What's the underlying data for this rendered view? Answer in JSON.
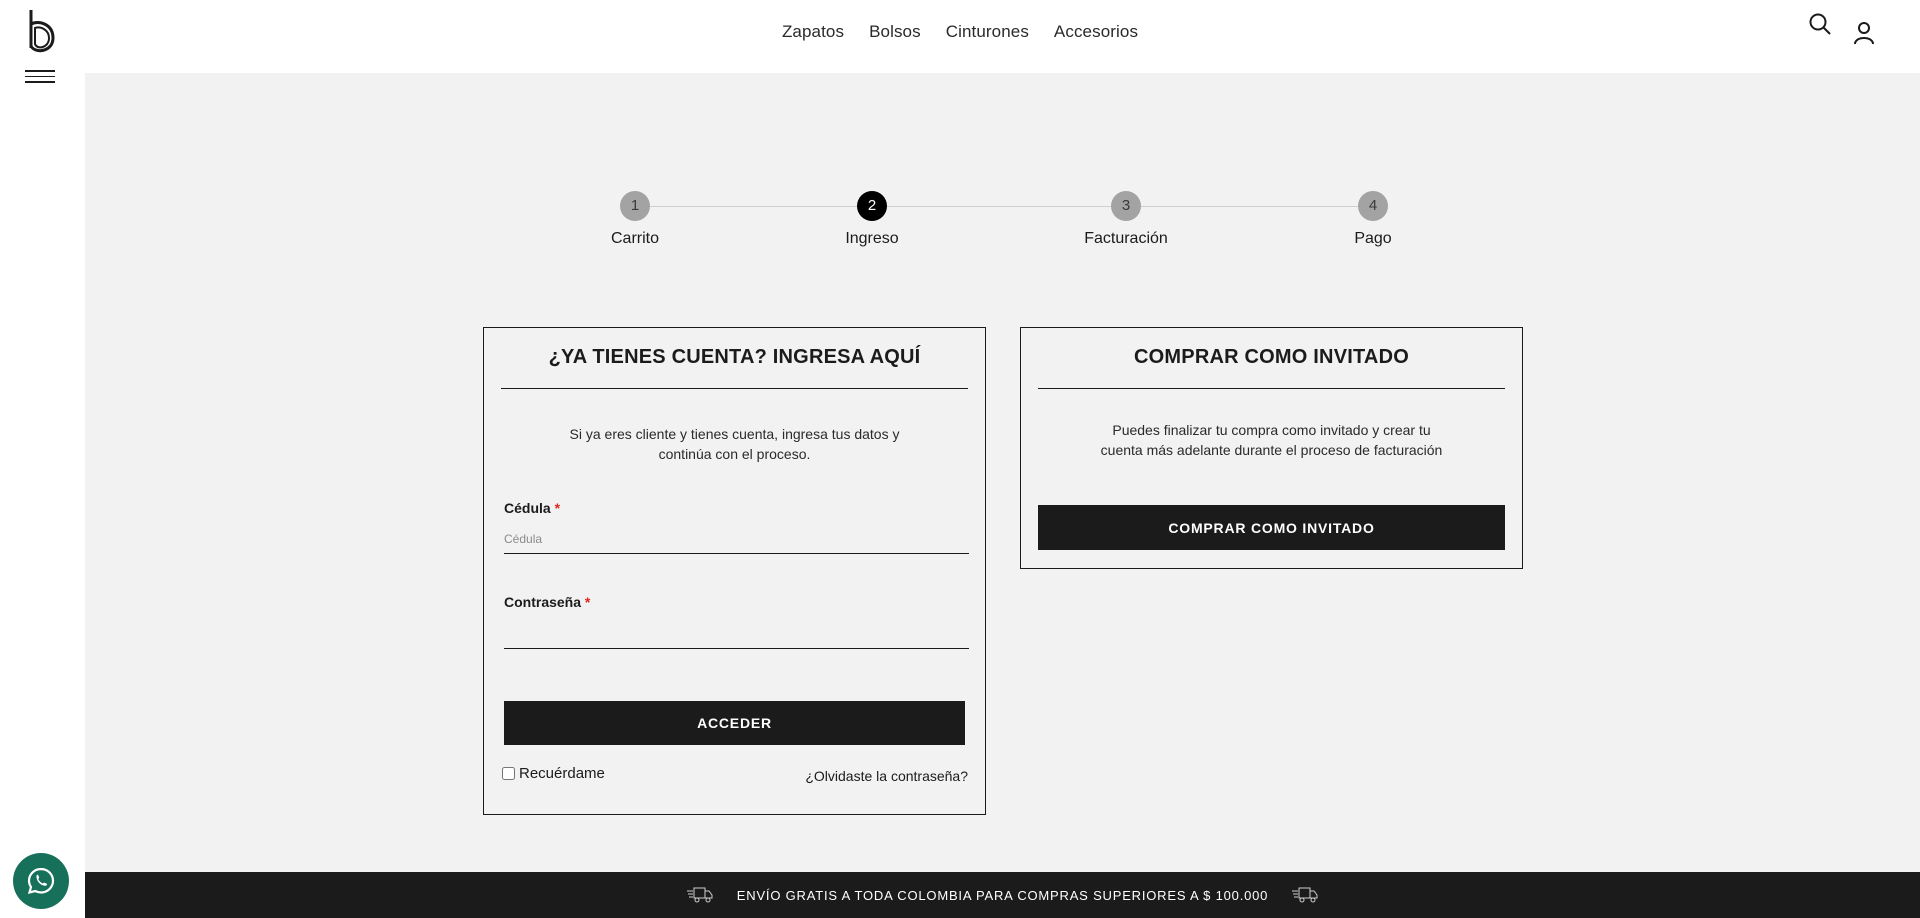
{
  "nav": {
    "items": [
      "Zapatos",
      "Bolsos",
      "Cinturones",
      "Accesorios"
    ]
  },
  "icons": {
    "logo": "logo-b",
    "menu": "hamburger-icon",
    "search": "search-icon",
    "user": "user-icon",
    "whatsapp": "whatsapp-icon",
    "truck": "truck-icon"
  },
  "steps": [
    {
      "number": "1",
      "label": "Carrito",
      "active": false
    },
    {
      "number": "2",
      "label": "Ingreso",
      "active": true
    },
    {
      "number": "3",
      "label": "Facturación",
      "active": false
    },
    {
      "number": "4",
      "label": "Pago",
      "active": false
    }
  ],
  "login": {
    "title": "¿YA TIENES CUENTA? INGRESA AQUÍ",
    "description_line1": "Si ya eres cliente y tienes cuenta, ingresa tus datos y",
    "description_line2": "continúa con el proceso.",
    "cedula_label": "Cédula",
    "cedula_placeholder": "Cédula",
    "cedula_value": "",
    "password_label": "Contraseña",
    "password_value": "",
    "required_mark": "*",
    "submit_label": "ACCEDER",
    "remember_label": "Recuérdame",
    "remember_checked": false,
    "forgot_label": "¿Olvidaste la contraseña?"
  },
  "guest": {
    "title": "COMPRAR COMO INVITADO",
    "description_line1": "Puedes finalizar tu compra como invitado y crear tu",
    "description_line2": "cuenta más adelante durante el proceso de facturación",
    "button_label": "COMPRAR COMO INVITADO"
  },
  "shipping_banner": {
    "text": "ENVÍO GRATIS A TODA COLOMBIA PARA COMPRAS SUPERIORES A $ 100.000"
  },
  "colors": {
    "dark": "#1b1b1b",
    "background": "#f2f2f2",
    "step_inactive": "#a3a3a3",
    "step_active": "#000000",
    "required": "#e0261d",
    "whatsapp": "#17705a"
  }
}
